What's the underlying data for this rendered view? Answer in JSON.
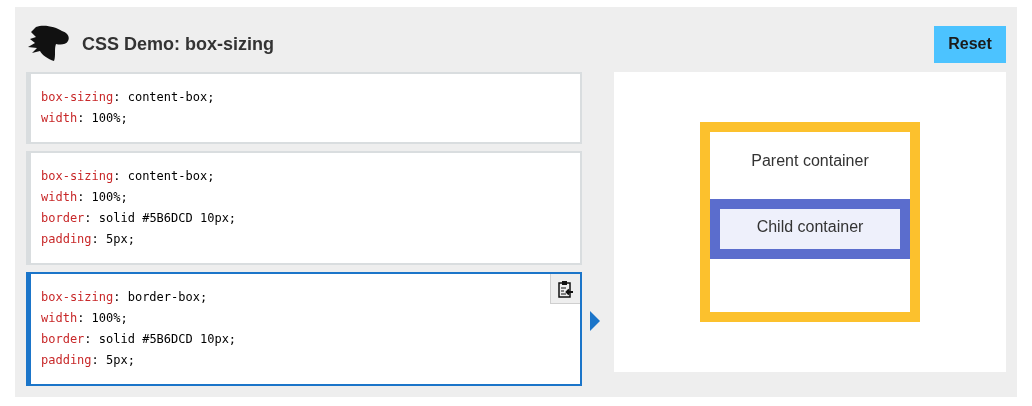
{
  "header": {
    "title": "CSS Demo: box-sizing",
    "reset_button": "Reset"
  },
  "code_blocks": [
    {
      "selected": false,
      "lines": [
        {
          "property": "box-sizing",
          "value": ": content-box;"
        },
        {
          "property": "width",
          "value": ": 100%;"
        }
      ]
    },
    {
      "selected": false,
      "lines": [
        {
          "property": "box-sizing",
          "value": ": content-box;"
        },
        {
          "property": "width",
          "value": ": 100%;"
        },
        {
          "property": "border",
          "value": ": solid #5B6DCD 10px;"
        },
        {
          "property": "padding",
          "value": ": 5px;"
        }
      ]
    },
    {
      "selected": true,
      "lines": [
        {
          "property": "box-sizing",
          "value": ": border-box;"
        },
        {
          "property": "width",
          "value": ": 100%;"
        },
        {
          "property": "border",
          "value": ": solid #5B6DCD 10px;"
        },
        {
          "property": "padding",
          "value": ": 5px;"
        }
      ]
    }
  ],
  "output": {
    "parent_label": "Parent container",
    "child_label": "Child container"
  }
}
